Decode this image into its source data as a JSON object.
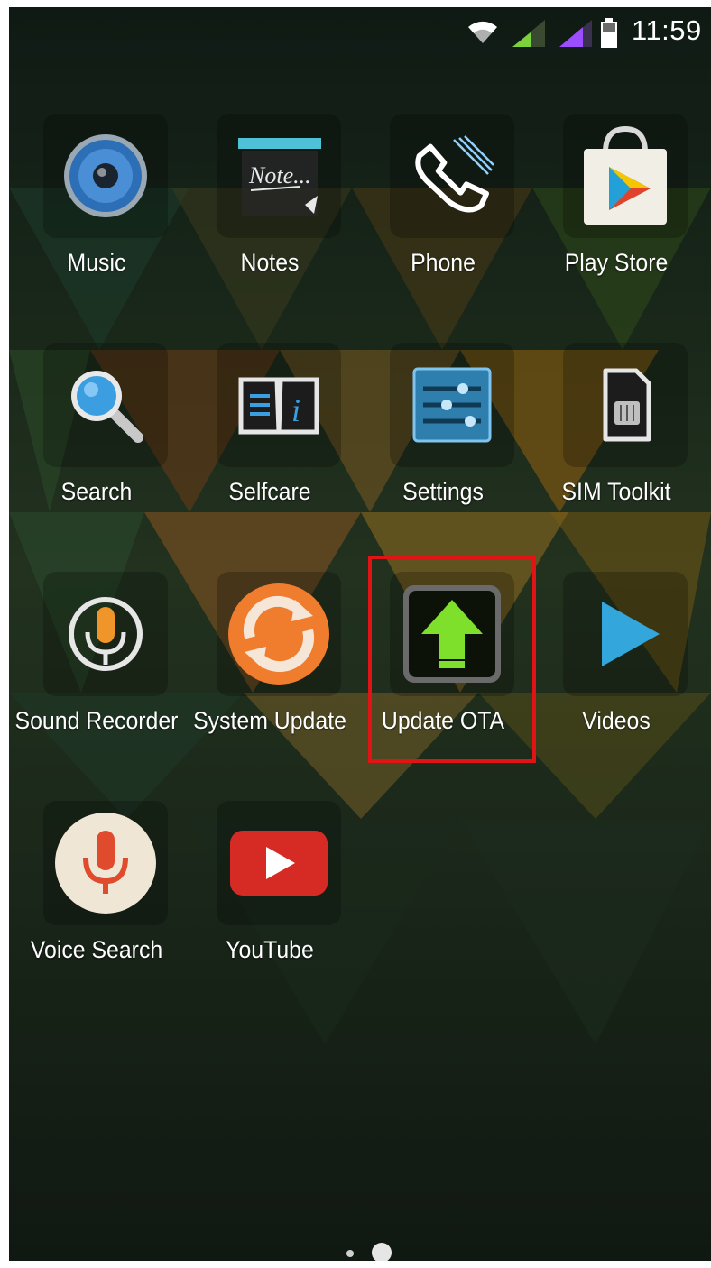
{
  "status_bar": {
    "time": "11:59",
    "icons": [
      "wifi-icon",
      "signal-sim1-icon",
      "signal-sim2-icon",
      "battery-icon"
    ],
    "sim1_color": "#7bd23a",
    "sim2_color": "#9b4dff"
  },
  "apps": [
    {
      "label": "Music",
      "icon": "speaker-icon"
    },
    {
      "label": "Notes",
      "icon": "notepad-icon",
      "icon_text": "Note..."
    },
    {
      "label": "Phone",
      "icon": "handset-icon"
    },
    {
      "label": "Play Store",
      "icon": "shopping-bag-icon"
    },
    {
      "label": "Search",
      "icon": "magnifier-icon"
    },
    {
      "label": "Selfcare",
      "icon": "book-info-icon"
    },
    {
      "label": "Settings",
      "icon": "sliders-icon"
    },
    {
      "label": "SIM Toolkit",
      "icon": "sim-card-icon"
    },
    {
      "label": "Sound Recorder",
      "icon": "microphone-icon"
    },
    {
      "label": "System Update",
      "icon": "refresh-icon"
    },
    {
      "label": "Update OTA",
      "icon": "upload-arrow-icon"
    },
    {
      "label": "Videos",
      "icon": "play-icon"
    },
    {
      "label": "Voice Search",
      "icon": "mic-search-icon"
    },
    {
      "label": "YouTube",
      "icon": "youtube-icon"
    }
  ],
  "highlighted_app": "Update OTA",
  "highlight_color": "#e01414",
  "pager": {
    "pages": 2,
    "current": 2
  }
}
